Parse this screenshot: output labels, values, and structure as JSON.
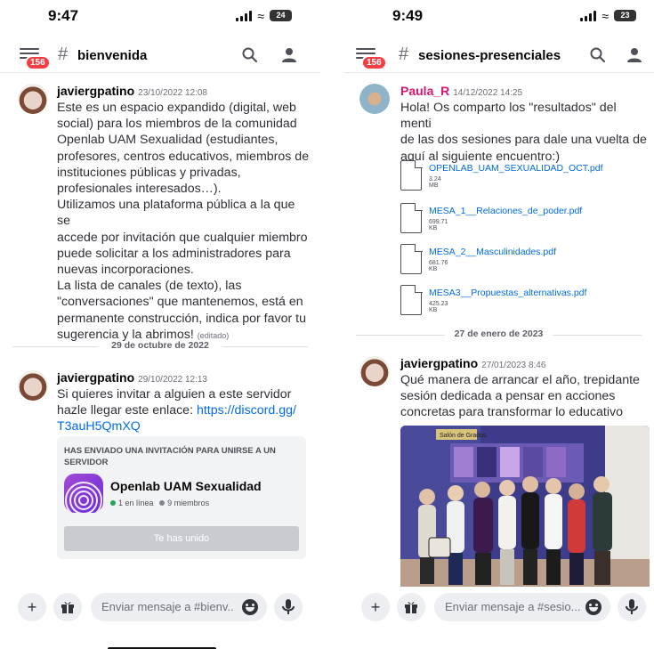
{
  "colors": {
    "accent": "#5865f2",
    "link": "#006ce7",
    "badge": "#f23f43",
    "online": "#23a55a",
    "offline": "#80848e",
    "paula": "#d5166f"
  },
  "left": {
    "status": {
      "time": "9:47",
      "battery": "24"
    },
    "header": {
      "badge": "156",
      "channel": "bienvenida",
      "icons": [
        "search-icon",
        "members-icon"
      ]
    },
    "messages": [
      {
        "author": "javiergpatino",
        "timestamp": "23/10/2022 12:08",
        "lines": [
          "Este es un espacio expandido (digital, web",
          "social) para los miembros de la comunidad",
          "Openlab UAM Sexualidad (estudiantes,",
          "profesores, centros educativos, miembros de",
          "instituciones públicas y privadas,",
          "profesionales interesados…).",
          "Utilizamos una plataforma pública a la que se",
          "accede por invitación que cualquier miembro",
          "puede solicitar a los administradores para",
          "nuevas incorporaciones.",
          "La lista de canales (de texto), las",
          "\"conversaciones\" que mantenemos, está en",
          "permanente construcción,  indica por favor tu",
          "sugerencia y la abrimos!"
        ],
        "edited": "(editado)"
      },
      {
        "author": "javiergpatino",
        "timestamp": "29/10/2022 12:13",
        "lines": [
          "Si quieres invitar a alguien a este servidor",
          "hazle llegar este enlace: "
        ],
        "link_part1": "https://discord.gg/",
        "link_part2": "T3auH5QmXQ"
      }
    ],
    "divider": "29 de octubre de 2022",
    "invite": {
      "title": "HAS ENVIADO UNA INVITACIÓN PARA UNIRSE A UN SERVIDOR",
      "server_name": "Openlab UAM Sexualidad",
      "online": "1 en línea",
      "members": "9 miembros",
      "button": "Te has unido"
    },
    "composer": {
      "placeholder": "Enviar mensaje a #bienv.."
    }
  },
  "right": {
    "status": {
      "time": "9:49",
      "battery": "23"
    },
    "header": {
      "badge": "156",
      "channel": "sesiones-presenciales",
      "icons": [
        "search-icon",
        "members-icon"
      ]
    },
    "message1": {
      "author": "Paula_R",
      "timestamp": "14/12/2022 14:25",
      "lines": [
        "Hola! Os comparto los \"resultados\" del menti",
        "de las dos sesiones para dale una vuelta de",
        "aquí al siguiente encuentro:)"
      ],
      "files": [
        {
          "name": "OPENLAB_UAM_SEXUALIDAD_OCT.pdf",
          "size": "3.24 MB"
        },
        {
          "name": "MESA_1__Relaciones_de_poder.pdf",
          "size": "699.71 KB"
        },
        {
          "name": "MESA_2__Masculinidades.pdf",
          "size": "681.76 KB"
        },
        {
          "name": "MESA3__Propuestas_alternativas.pdf",
          "size": "425.23 KB"
        }
      ]
    },
    "divider": "27 de enero de 2023",
    "message2": {
      "author": "javiergpatino",
      "timestamp": "27/01/2023 8:46",
      "lines": [
        "Qué manera de arrancar el año, trepidante",
        "sesión dedicada a pensar en acciones",
        "concretas para transformar lo educativo"
      ],
      "photo_sign": "Salón de Grados"
    },
    "composer": {
      "placeholder": "Enviar mensaje a #sesio..."
    }
  }
}
